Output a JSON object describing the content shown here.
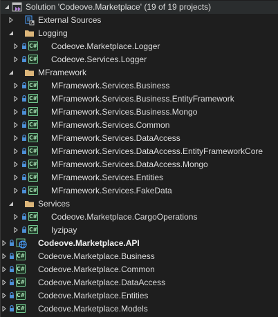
{
  "solution": {
    "title": "Solution 'Codeove.Marketplace' (19 of 19 projects)"
  },
  "csharp_badge": "C#",
  "colors": {
    "background": "#1e1e1e",
    "text": "#dcdcdc",
    "folder": "#dcb67a",
    "csharp_project": "#73c991",
    "web_globe": "#4aa0ff",
    "lock": "#4c8fd6"
  },
  "tree": {
    "external_sources": "External Sources",
    "folders": {
      "logging": "Logging",
      "mframework": "MFramework",
      "services": "Services"
    },
    "logging_projects": [
      "Codeove.Marketplace.Logger",
      "Codeove.Services.Logger"
    ],
    "mframework_projects": [
      "MFramework.Services.Business",
      "MFramework.Services.Business.EntityFramework",
      "MFramework.Services.Business.Mongo",
      "MFramework.Services.Common",
      "MFramework.Services.DataAccess",
      "MFramework.Services.DataAccess.EntityFrameworkCore",
      "MFramework.Services.DataAccess.Mongo",
      "MFramework.Services.Entities",
      "MFramework.Services.FakeData"
    ],
    "services_projects": [
      "Codeove.Marketplace.CargoOperations",
      "Iyzipay"
    ],
    "startup_project": "Codeove.Marketplace.API",
    "root_projects": [
      "Codeove.Marketplace.Business",
      "Codeove.Marketplace.Common",
      "Codeove.Marketplace.DataAccess",
      "Codeove.Marketplace.Entities",
      "Codeove.Marketplace.Models"
    ]
  }
}
